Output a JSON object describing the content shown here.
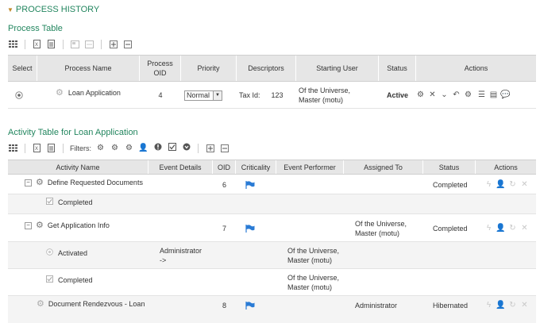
{
  "header": {
    "title": "PROCESS HISTORY"
  },
  "process_table": {
    "title": "Process Table",
    "columns": [
      "Select",
      "Process Name",
      "Process OID",
      "Priority",
      "Descriptors",
      "Starting User",
      "Status",
      "Actions"
    ],
    "row": {
      "process_name": "Loan Application",
      "oid": "4",
      "priority": "Normal",
      "descriptor_label": "Tax Id:",
      "descriptor_value": "123",
      "starting_user_line1": "Of the Universe,",
      "starting_user_line2": "Master (motu)",
      "status": "Active"
    }
  },
  "activity_table": {
    "title": "Activity Table for Loan Application",
    "filters_label": "Filters:",
    "columns": [
      "Activity Name",
      "Event Details",
      "OID",
      "Criticality",
      "Event Performer",
      "Assigned To",
      "Status",
      "Actions"
    ],
    "rows": [
      {
        "name": "Define Requested Documents",
        "oid": "6",
        "status": "Completed"
      },
      {
        "name": "Completed"
      },
      {
        "name": "Get Application Info",
        "oid": "7",
        "assigned_line1": "Of the Universe,",
        "assigned_line2": "Master (motu)",
        "status": "Completed"
      },
      {
        "name": "Activated",
        "event_line1": "Administrator",
        "event_line2": "->",
        "performer_line1": "Of the Universe,",
        "performer_line2": "Master (motu)"
      },
      {
        "name": "Completed",
        "performer_line1": "Of the Universe,",
        "performer_line2": "Master (motu)"
      },
      {
        "name": "Document Rendezvous - Loan",
        "oid": "8",
        "assigned": "Administrator",
        "status": "Hibernated"
      }
    ]
  },
  "colors": {
    "accent": "#23865f",
    "flag": "#2a7bd5",
    "header_bg": "#e6e6e6"
  }
}
